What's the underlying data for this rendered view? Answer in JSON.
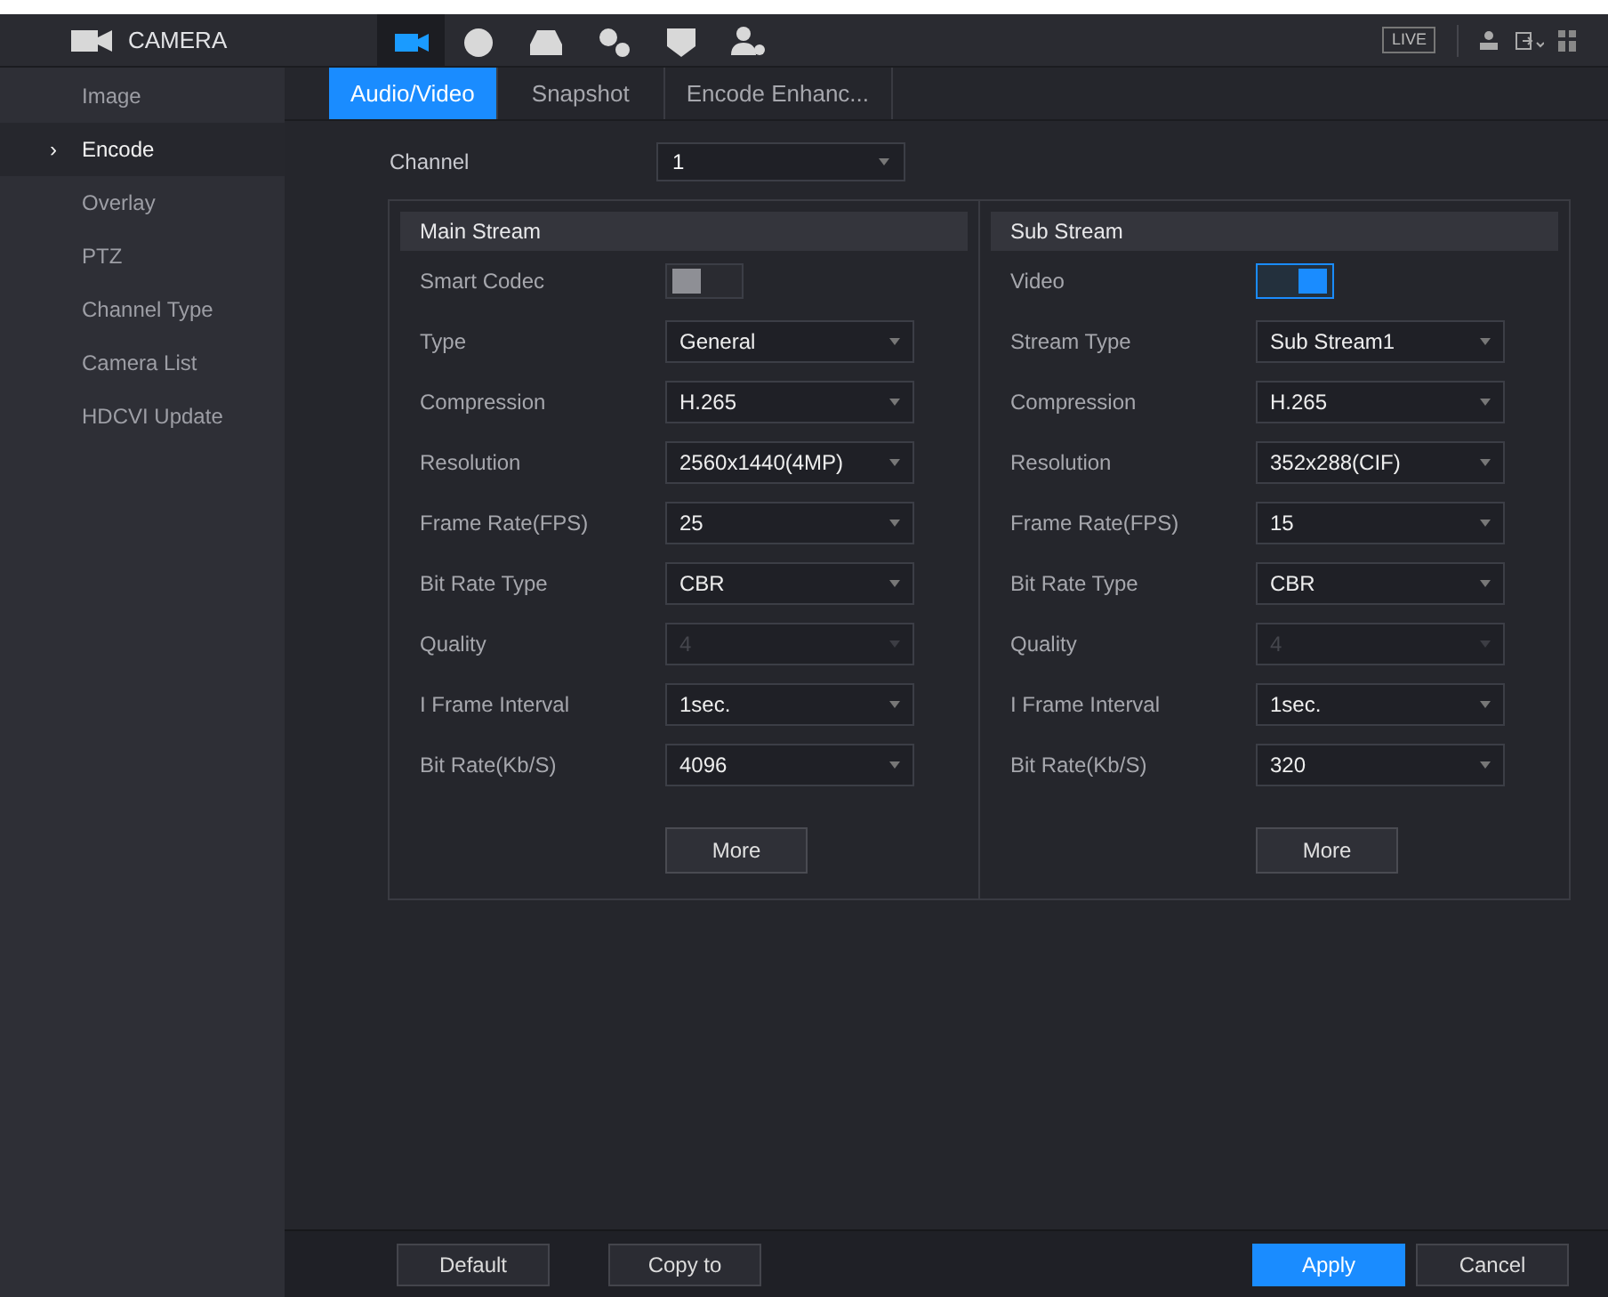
{
  "header": {
    "title": "CAMERA",
    "live": "LIVE",
    "icons": [
      {
        "kind": "camera",
        "selected": true
      },
      {
        "kind": "network",
        "selected": false
      },
      {
        "kind": "storage",
        "selected": false
      },
      {
        "kind": "system",
        "selected": false
      },
      {
        "kind": "security",
        "selected": false
      },
      {
        "kind": "account",
        "selected": false
      }
    ]
  },
  "sidebar": {
    "items": [
      {
        "label": "Image",
        "selected": false
      },
      {
        "label": "Encode",
        "selected": true,
        "marker": "›"
      },
      {
        "label": "Overlay",
        "selected": false
      },
      {
        "label": "PTZ",
        "selected": false
      },
      {
        "label": "Channel Type",
        "selected": false
      },
      {
        "label": "Camera List",
        "selected": false
      },
      {
        "label": "HDCVI Update",
        "selected": false
      }
    ]
  },
  "tabs": [
    {
      "label": "Audio/Video",
      "selected": true
    },
    {
      "label": "Snapshot",
      "selected": false
    },
    {
      "label": "Encode Enhanc...",
      "selected": false
    }
  ],
  "channel": {
    "label": "Channel",
    "value": "1"
  },
  "streams": [
    {
      "title": "Main Stream",
      "rows": [
        {
          "kind": "toggle",
          "label": "Smart Codec",
          "on": false
        },
        {
          "kind": "select",
          "label": "Type",
          "value": "General",
          "disabled": false
        },
        {
          "kind": "select",
          "label": "Compression",
          "value": "H.265",
          "disabled": false
        },
        {
          "kind": "select",
          "label": "Resolution",
          "value": "2560x1440(4MP)",
          "disabled": false
        },
        {
          "kind": "select",
          "label": "Frame Rate(FPS)",
          "value": "25",
          "disabled": false
        },
        {
          "kind": "select",
          "label": "Bit Rate Type",
          "value": "CBR",
          "disabled": false
        },
        {
          "kind": "select",
          "label": "Quality",
          "value": "4",
          "disabled": true
        },
        {
          "kind": "select",
          "label": "I Frame Interval",
          "value": "1sec.",
          "disabled": false
        },
        {
          "kind": "select",
          "label": "Bit Rate(Kb/S)",
          "value": "4096",
          "disabled": false
        }
      ],
      "button": "More"
    },
    {
      "title": "Sub Stream",
      "rows": [
        {
          "kind": "toggle",
          "label": "Video",
          "on": true
        },
        {
          "kind": "select",
          "label": "Stream Type",
          "value": "Sub Stream1",
          "disabled": false
        },
        {
          "kind": "select",
          "label": "Compression",
          "value": "H.265",
          "disabled": false
        },
        {
          "kind": "select",
          "label": "Resolution",
          "value": "352x288(CIF)",
          "disabled": false
        },
        {
          "kind": "select",
          "label": "Frame Rate(FPS)",
          "value": "15",
          "disabled": false
        },
        {
          "kind": "select",
          "label": "Bit Rate Type",
          "value": "CBR",
          "disabled": false
        },
        {
          "kind": "select",
          "label": "Quality",
          "value": "4",
          "disabled": true
        },
        {
          "kind": "select",
          "label": "I Frame Interval",
          "value": "1sec.",
          "disabled": false
        },
        {
          "kind": "select",
          "label": "Bit Rate(Kb/S)",
          "value": "320",
          "disabled": false
        }
      ],
      "button": "More"
    }
  ],
  "footer": {
    "left_buttons": [
      "Default",
      "Copy to"
    ],
    "apply": "Apply",
    "cancel": "Cancel"
  }
}
